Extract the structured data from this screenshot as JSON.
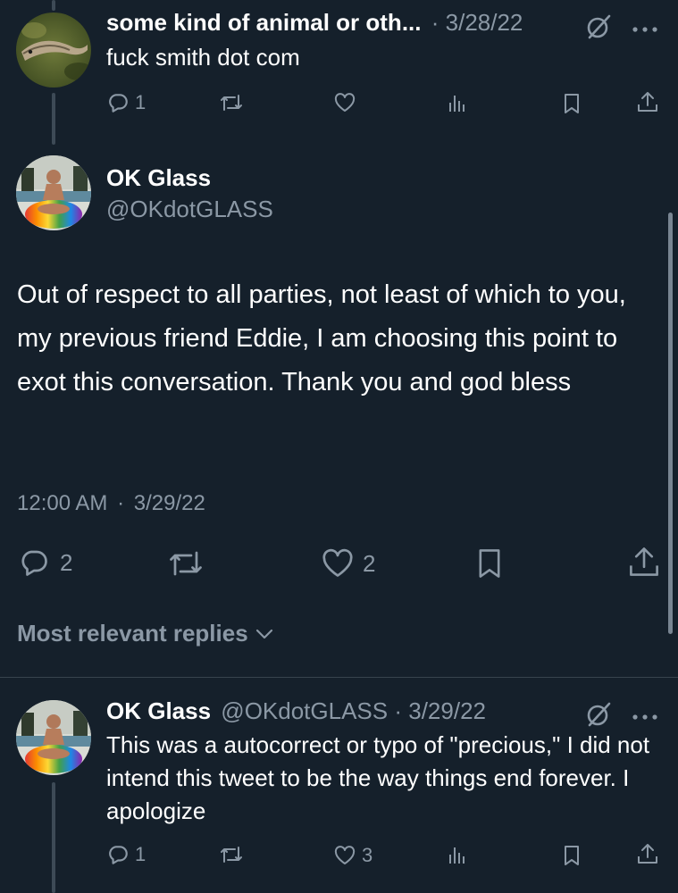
{
  "colors": {
    "background": "#15202b",
    "text_primary": "#ffffff",
    "text_secondary": "#8b98a5",
    "divider": "#38444d"
  },
  "parent_tweet": {
    "author_name": "some kind of animal or oth...",
    "separator": "·",
    "date": "3/28/22",
    "text": "fuck smith dot com",
    "reply_count": "1",
    "avatar_icon": "eel-photo-avatar"
  },
  "main_tweet": {
    "author_name": "OK Glass",
    "handle": "@OKdotGLASS",
    "text": "Out of respect to all parties, not least of which to you, my previous friend Eddie, I am choosing this point to exot this conversation. Thank you and god bless",
    "time": "12:00 AM",
    "separator": "·",
    "date": "3/29/22",
    "reply_count": "2",
    "like_count": "2",
    "avatar_icon": "man-with-rainbow-float-avatar"
  },
  "replies_filter": {
    "label": "Most relevant replies"
  },
  "reply_tweet": {
    "author_name": "OK Glass",
    "handle": "@OKdotGLASS",
    "separator": "·",
    "date": "3/29/22",
    "text": "This was a autocorrect or typo of \"precious,\" I did not intend this tweet to be the way things end forever. I apologize",
    "reply_count": "1",
    "like_count": "3",
    "avatar_icon": "man-with-rainbow-float-avatar"
  }
}
